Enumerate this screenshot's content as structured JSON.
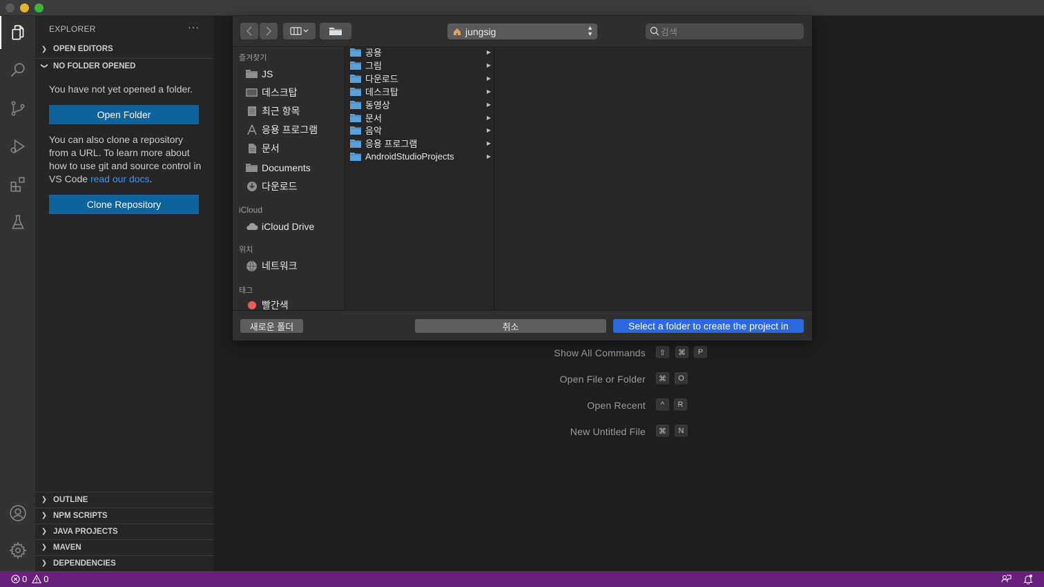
{
  "window": {
    "title": ""
  },
  "activity_bar": {
    "items": [
      "explorer-icon",
      "search-icon",
      "source-control-icon",
      "run-debug-icon",
      "extensions-icon",
      "testing-icon"
    ],
    "bottom_items": [
      "account-icon",
      "settings-gear-icon"
    ]
  },
  "sidebar": {
    "header": "EXPLORER",
    "more": "···",
    "sections": {
      "open_editors": "OPEN EDITORS",
      "no_folder": "NO FOLDER OPENED",
      "outline": "OUTLINE",
      "npm_scripts": "NPM SCRIPTS",
      "java_projects": "JAVA PROJECTS",
      "maven": "MAVEN",
      "dependencies": "DEPENDENCIES"
    },
    "no_folder_text": "You have not yet opened a folder.",
    "open_folder_button": "Open Folder",
    "clone_text_before": "You can also clone a repository from a URL. To learn more about how to use git and source control in VS Code ",
    "clone_text_link": "read our docs",
    "clone_text_after": ".",
    "clone_button": "Clone Repository"
  },
  "dialog": {
    "location": "jungsig",
    "search_placeholder": "검색",
    "sidebar": {
      "favorites_header": "즐겨찾기",
      "favorites": [
        {
          "label": "JS",
          "icon": "folder-icon"
        },
        {
          "label": "데스크탑",
          "icon": "desktop-icon"
        },
        {
          "label": "최근 항목",
          "icon": "recents-icon"
        },
        {
          "label": "응용 프로그램",
          "icon": "applications-icon"
        },
        {
          "label": "문서",
          "icon": "document-icon"
        },
        {
          "label": "Documents",
          "icon": "folder-icon"
        },
        {
          "label": "다운로드",
          "icon": "download-icon"
        }
      ],
      "icloud_header": "iCloud",
      "icloud": [
        {
          "label": "iCloud Drive",
          "icon": "cloud-icon"
        }
      ],
      "locations_header": "위치",
      "locations": [
        {
          "label": "네트워크",
          "icon": "network-icon"
        }
      ],
      "tags_header": "태그",
      "tags": [
        {
          "label": "빨간색",
          "color": "#ec5b56"
        }
      ]
    },
    "folders": [
      "공용",
      "그림",
      "다운로드",
      "데스크탑",
      "동영상",
      "문서",
      "음악",
      "응용 프로그램",
      "AndroidStudioProjects"
    ],
    "new_folder_button": "새로운 폴더",
    "cancel_button": "취소",
    "confirm_button": "Select a folder to create the project in"
  },
  "welcome_commands": [
    {
      "label": "Show All Commands",
      "keys": [
        "⇧",
        "⌘",
        "P"
      ]
    },
    {
      "label": "Open File or Folder",
      "keys": [
        "⌘",
        "O"
      ]
    },
    {
      "label": "Open Recent",
      "keys": [
        "^",
        "R"
      ]
    },
    {
      "label": "New Untitled File",
      "keys": [
        "⌘",
        "N"
      ]
    }
  ],
  "status_bar": {
    "errors": "0",
    "warnings": "0",
    "color": "#68217a"
  }
}
